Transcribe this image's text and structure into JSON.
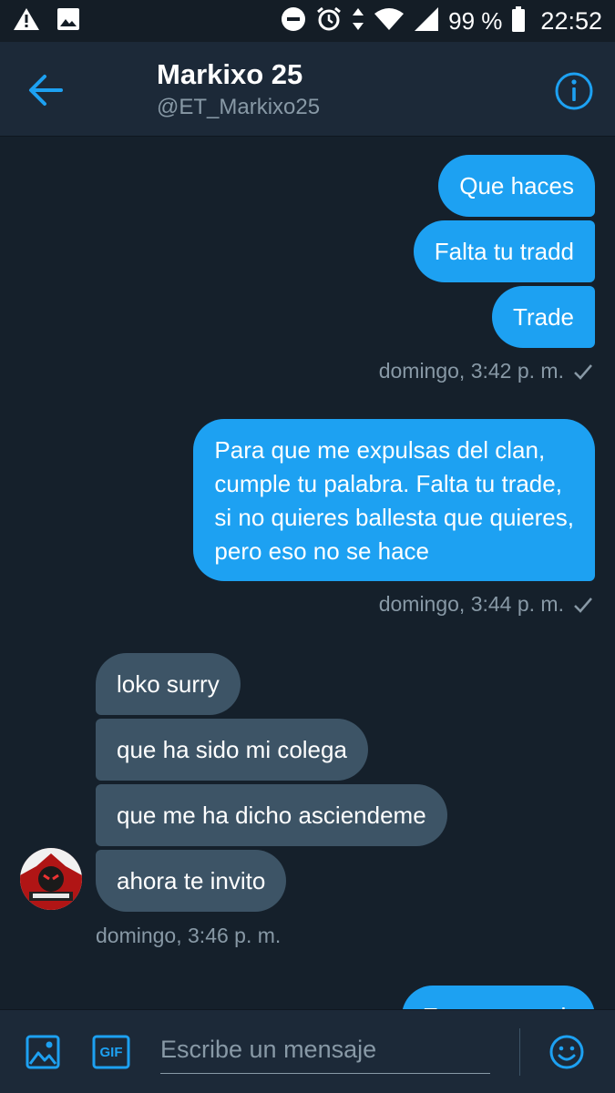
{
  "status_bar": {
    "battery_label": "99 %",
    "time": "22:52",
    "icons": [
      "warning-icon",
      "image-notification-icon",
      "do-not-disturb-icon",
      "alarm-icon",
      "data-arrows-icon",
      "wifi-icon",
      "signal-icon",
      "battery-icon"
    ]
  },
  "header": {
    "name": "Markixo 25",
    "handle": "@ET_Markixo25",
    "back_icon": "back-arrow-icon",
    "info_icon": "info-icon"
  },
  "messages": {
    "group1": [
      "Que haces",
      "Falta tu tradd",
      "Trade"
    ],
    "group1_time": "domingo, 3:42 p. m.",
    "group2_lines": [
      "Para que me expulsas del clan,",
      "cumple tu palabra. Falta tu trade,",
      "si no quieres ballesta que quieres,",
      "pero eso no se hace"
    ],
    "group2_time": "domingo, 3:44 p. m.",
    "group3": [
      "loko surry",
      "que ha sido mi colega",
      "que me ha dicho asciendeme",
      "ahora te invito"
    ],
    "group3_time": "domingo, 3:46 p. m.",
    "partial": "Esta vez tendr"
  },
  "composer": {
    "placeholder": "Escribe un mensaje",
    "gif_label": "GIF"
  },
  "colors": {
    "background": "#15202b",
    "bar": "#1c2938",
    "outgoing": "#1da1f2",
    "incoming": "#3d5466",
    "muted": "#8899a6"
  }
}
